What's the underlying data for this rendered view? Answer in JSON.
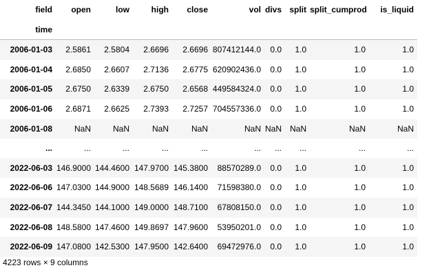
{
  "table": {
    "index_name_top": "field",
    "index_name_bottom": "time",
    "columns": [
      "open",
      "low",
      "high",
      "close",
      "vol",
      "divs",
      "split",
      "split_cumprod",
      "is_liquid"
    ],
    "rows": [
      {
        "index": "2006-01-03",
        "cells": [
          "2.5861",
          "2.5804",
          "2.6696",
          "2.6696",
          "807412144.0",
          "0.0",
          "1.0",
          "1.0",
          "1.0"
        ]
      },
      {
        "index": "2006-01-04",
        "cells": [
          "2.6850",
          "2.6607",
          "2.7136",
          "2.6775",
          "620902436.0",
          "0.0",
          "1.0",
          "1.0",
          "1.0"
        ]
      },
      {
        "index": "2006-01-05",
        "cells": [
          "2.6750",
          "2.6339",
          "2.6750",
          "2.6568",
          "449584324.0",
          "0.0",
          "1.0",
          "1.0",
          "1.0"
        ]
      },
      {
        "index": "2006-01-06",
        "cells": [
          "2.6871",
          "2.6625",
          "2.7393",
          "2.7257",
          "704557336.0",
          "0.0",
          "1.0",
          "1.0",
          "1.0"
        ]
      },
      {
        "index": "2006-01-08",
        "cells": [
          "NaN",
          "NaN",
          "NaN",
          "NaN",
          "NaN",
          "NaN",
          "NaN",
          "NaN",
          "NaN"
        ]
      },
      {
        "index": "...",
        "cells": [
          "...",
          "...",
          "...",
          "...",
          "...",
          "...",
          "...",
          "...",
          "..."
        ]
      },
      {
        "index": "2022-06-03",
        "cells": [
          "146.9000",
          "144.4600",
          "147.9700",
          "145.3800",
          "88570289.0",
          "0.0",
          "1.0",
          "1.0",
          "1.0"
        ]
      },
      {
        "index": "2022-06-06",
        "cells": [
          "147.0300",
          "144.9000",
          "148.5689",
          "146.1400",
          "71598380.0",
          "0.0",
          "1.0",
          "1.0",
          "1.0"
        ]
      },
      {
        "index": "2022-06-07",
        "cells": [
          "144.3450",
          "144.1000",
          "149.0000",
          "148.7100",
          "67808150.0",
          "0.0",
          "1.0",
          "1.0",
          "1.0"
        ]
      },
      {
        "index": "2022-06-08",
        "cells": [
          "148.5800",
          "147.4600",
          "149.8697",
          "147.9600",
          "53950201.0",
          "0.0",
          "1.0",
          "1.0",
          "1.0"
        ]
      },
      {
        "index": "2022-06-09",
        "cells": [
          "147.0800",
          "142.5300",
          "147.9500",
          "142.6400",
          "69472976.0",
          "0.0",
          "1.0",
          "1.0",
          "1.0"
        ]
      }
    ],
    "shape_text": "4223 rows × 9 columns"
  }
}
